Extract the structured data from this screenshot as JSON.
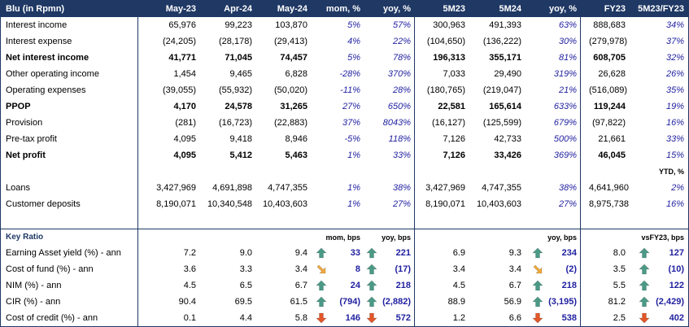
{
  "header": {
    "title": "Blu (in Rpmn)",
    "cols": [
      "May-23",
      "Apr-24",
      "May-24",
      "mom, %",
      "yoy, %",
      "5M23",
      "5M24",
      "yoy, %",
      "FY23",
      "5M23/FY23"
    ]
  },
  "rows": [
    {
      "label": "Interest income",
      "bold": false,
      "v": [
        "65,976",
        "99,223",
        "103,870",
        "5%",
        "57%",
        "300,963",
        "491,393",
        "63%",
        "888,683",
        "34%"
      ]
    },
    {
      "label": "Interest expense",
      "bold": false,
      "v": [
        "(24,205)",
        "(28,178)",
        "(29,413)",
        "4%",
        "22%",
        "(104,650)",
        "(136,222)",
        "30%",
        "(279,978)",
        "37%"
      ]
    },
    {
      "label": "Net interest income",
      "bold": true,
      "v": [
        "41,771",
        "71,045",
        "74,457",
        "5%",
        "78%",
        "196,313",
        "355,171",
        "81%",
        "608,705",
        "32%"
      ]
    },
    {
      "label": "Other operating income",
      "bold": false,
      "v": [
        "1,454",
        "9,465",
        "6,828",
        "-28%",
        "370%",
        "7,033",
        "29,490",
        "319%",
        "26,628",
        "26%"
      ]
    },
    {
      "label": "Operating expenses",
      "bold": false,
      "v": [
        "(39,055)",
        "(55,932)",
        "(50,020)",
        "-11%",
        "28%",
        "(180,765)",
        "(219,047)",
        "21%",
        "(516,089)",
        "35%"
      ]
    },
    {
      "label": "PPOP",
      "bold": true,
      "v": [
        "4,170",
        "24,578",
        "31,265",
        "27%",
        "650%",
        "22,581",
        "165,614",
        "633%",
        "119,244",
        "19%"
      ]
    },
    {
      "label": "Provision",
      "bold": false,
      "v": [
        "(281)",
        "(16,723)",
        "(22,883)",
        "37%",
        "8043%",
        "(16,127)",
        "(125,599)",
        "679%",
        "(97,822)",
        "16%"
      ]
    },
    {
      "label": "Pre-tax profit",
      "bold": false,
      "v": [
        "4,095",
        "9,418",
        "8,946",
        "-5%",
        "118%",
        "7,126",
        "42,733",
        "500%",
        "21,661",
        "33%"
      ]
    },
    {
      "label": "Net profit",
      "bold": true,
      "v": [
        "4,095",
        "5,412",
        "5,463",
        "1%",
        "33%",
        "7,126",
        "33,426",
        "369%",
        "46,045",
        "15%"
      ]
    }
  ],
  "ytd_label": "YTD, %",
  "rows2": [
    {
      "label": "Loans",
      "v": [
        "3,427,969",
        "4,691,898",
        "4,747,355",
        "1%",
        "38%",
        "3,427,969",
        "4,747,355",
        "38%",
        "4,641,960",
        "2%"
      ]
    },
    {
      "label": "Customer deposits",
      "v": [
        "8,190,071",
        "10,340,548",
        "10,403,603",
        "1%",
        "27%",
        "8,190,071",
        "10,403,603",
        "27%",
        "8,975,738",
        "16%"
      ]
    }
  ],
  "ratio_section": {
    "title": "Key Ratio",
    "mom_label": "mom, bps",
    "yoy_label": "yoy, bps",
    "yoy5_label": "yoy, bps",
    "vsfy_label": "vsFY23, bps"
  },
  "ratios": [
    {
      "label": "Earning Asset yield (%) - ann",
      "may23": "7.2",
      "apr24": "9.0",
      "may24": "9.4",
      "mom_icon": "up",
      "mom": "33",
      "yoy_icon": "up",
      "yoy": "221",
      "m5_23": "6.9",
      "m5_24": "9.3",
      "yoy5_icon": "up",
      "yoy5": "234",
      "fy23": "8.0",
      "vs_icon": "up",
      "vs": "127"
    },
    {
      "label": "Cost of fund (%) - ann",
      "may23": "3.6",
      "apr24": "3.3",
      "may24": "3.4",
      "mom_icon": "side",
      "mom": "8",
      "yoy_icon": "up",
      "yoy": "(17)",
      "m5_23": "3.4",
      "m5_24": "3.4",
      "yoy5_icon": "side",
      "yoy5": "(2)",
      "fy23": "3.5",
      "vs_icon": "up",
      "vs": "(10)"
    },
    {
      "label": "NIM (%) - ann",
      "may23": "4.5",
      "apr24": "6.5",
      "may24": "6.7",
      "mom_icon": "up",
      "mom": "24",
      "yoy_icon": "up",
      "yoy": "218",
      "m5_23": "4.5",
      "m5_24": "6.7",
      "yoy5_icon": "up",
      "yoy5": "218",
      "fy23": "5.5",
      "vs_icon": "up",
      "vs": "122"
    },
    {
      "label": "CIR (%) - ann",
      "may23": "90.4",
      "apr24": "69.5",
      "may24": "61.5",
      "mom_icon": "up",
      "mom": "(794)",
      "yoy_icon": "up",
      "yoy": "(2,882)",
      "m5_23": "88.9",
      "m5_24": "56.9",
      "yoy5_icon": "up",
      "yoy5": "(3,195)",
      "fy23": "81.2",
      "vs_icon": "up",
      "vs": "(2,429)"
    },
    {
      "label": "Cost of credit (%) - ann",
      "may23": "0.1",
      "apr24": "4.4",
      "may24": "5.8",
      "mom_icon": "down",
      "mom": "146",
      "yoy_icon": "down",
      "yoy": "572",
      "m5_23": "1.2",
      "m5_24": "6.6",
      "yoy5_icon": "down",
      "yoy5": "538",
      "fy23": "2.5",
      "vs_icon": "down",
      "vs": "402"
    }
  ],
  "colors": {
    "header": "#1f3864",
    "up": "#4a9a86",
    "down": "#e2572a",
    "side": "#f2a93b",
    "value": "#1f1fa0"
  }
}
